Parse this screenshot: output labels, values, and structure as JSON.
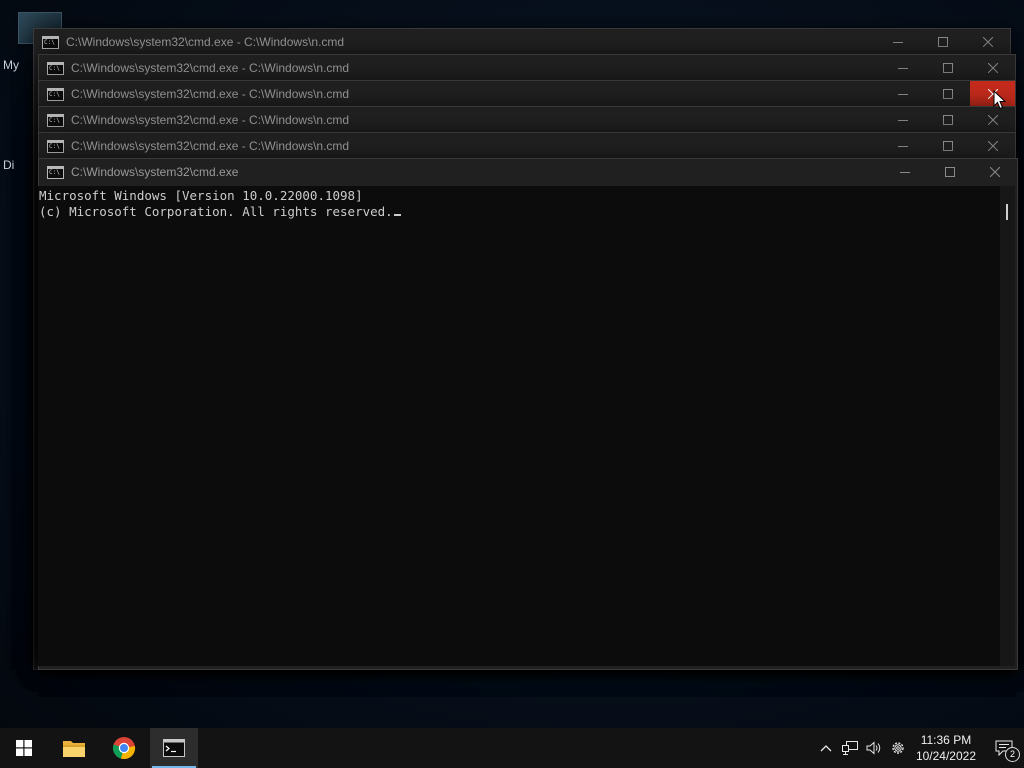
{
  "desktop": {
    "label_1": "My",
    "label_2": "Di"
  },
  "windows": [
    {
      "title": "C:\\Windows\\system32\\cmd.exe - C:\\Windows\\n.cmd"
    },
    {
      "title": "C:\\Windows\\system32\\cmd.exe - C:\\Windows\\n.cmd"
    },
    {
      "title": "C:\\Windows\\system32\\cmd.exe - C:\\Windows\\n.cmd"
    },
    {
      "title": "C:\\Windows\\system32\\cmd.exe - C:\\Windows\\n.cmd"
    },
    {
      "title": "C:\\Windows\\system32\\cmd.exe - C:\\Windows\\n.cmd"
    },
    {
      "title": "C:\\Windows\\system32\\cmd.exe"
    }
  ],
  "console": {
    "line_1": "Microsoft Windows [Version 10.0.22000.1098]",
    "line_2": "(c) Microsoft Corporation. All rights reserved."
  },
  "taskbar": {
    "apps": [
      {
        "icon": "windows-start-icon"
      },
      {
        "icon": "file-explorer-icon"
      },
      {
        "icon": "chrome-icon"
      },
      {
        "icon": "command-prompt-icon",
        "active": true
      }
    ],
    "tray": {
      "time": "11:36 PM",
      "date": "10/24/2022",
      "notification_count": "2"
    }
  },
  "colors": {
    "close_hover": "#c42b1c",
    "taskbar_bg": "#131313",
    "console_bg": "#0c0c0c",
    "active_indicator": "#76b9ed"
  }
}
